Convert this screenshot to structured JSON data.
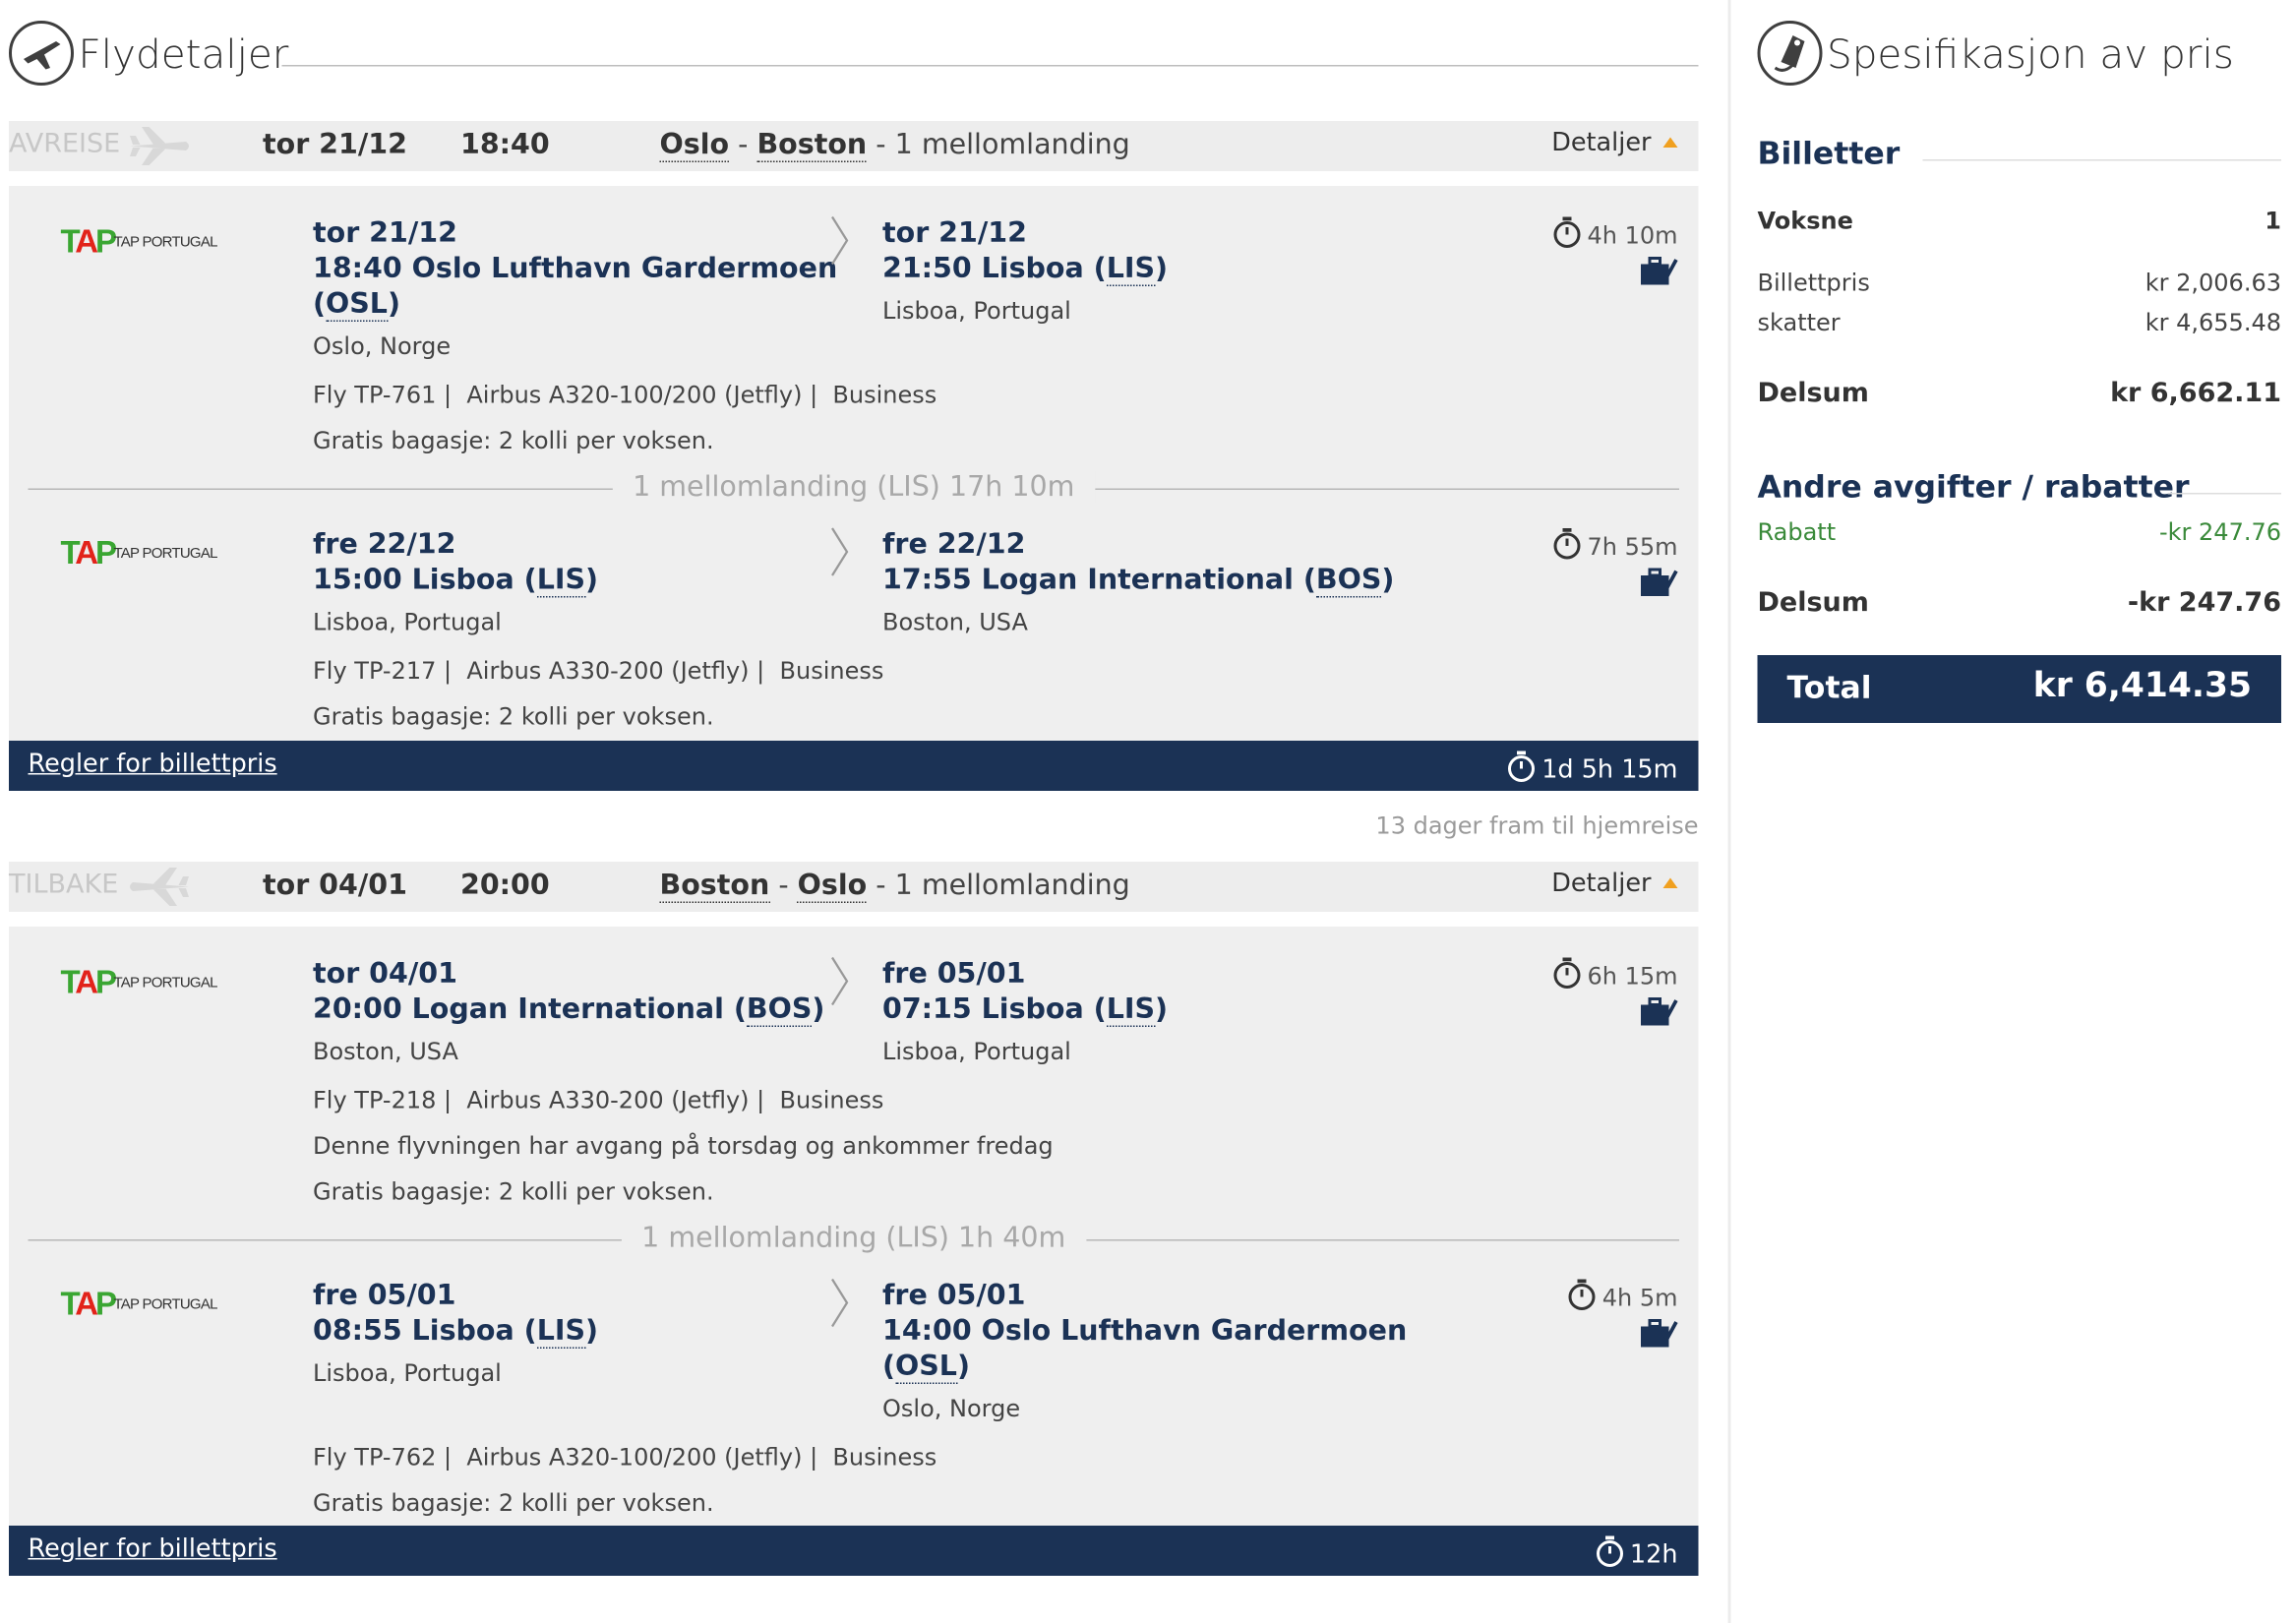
{
  "flight_details": {
    "title": "Flydetaljer",
    "trips": [
      {
        "direction": "AVREISE",
        "date": "tor 21/12",
        "time": "18:40",
        "route_from": "Oslo",
        "route_to": "Boston",
        "stops": "1 mellomlanding",
        "details_label": "Detaljer",
        "segments": [
          {
            "airline": "TAP PORTUGAL",
            "dep_date": "tor 21/12",
            "dep_time_place": "18:40 Oslo Lufthavn Gardermoen",
            "dep_code": "OSL",
            "dep_city": "Oslo, Norge",
            "arr_date": "tor 21/12",
            "arr_time_place": "21:50 Lisboa",
            "arr_code": "LIS",
            "arr_city": "Lisboa, Portugal",
            "duration": "4h 10m",
            "flight": "Fly TP-761",
            "aircraft": "Airbus A320-100/200 (Jetfly)",
            "cabin": "Business",
            "baggage": "Gratis bagasje: 2 kolli per voksen."
          },
          {
            "airline": "TAP PORTUGAL",
            "dep_date": "fre 22/12",
            "dep_time_place": "15:00 Lisboa",
            "dep_code": "LIS",
            "dep_city": "Lisboa, Portugal",
            "arr_date": "fre 22/12",
            "arr_time_place": "17:55 Logan International",
            "arr_code": "BOS",
            "arr_city": "Boston, USA",
            "duration": "7h 55m",
            "flight": "Fly TP-217",
            "aircraft": "Airbus A330-200 (Jetfly)",
            "cabin": "Business",
            "baggage": "Gratis bagasje: 2 kolli per voksen."
          }
        ],
        "layover": "1 mellomlanding (LIS) 17h 10m",
        "rules_label": "Regler for billettpris",
        "total_duration": "1d 5h 15m"
      },
      {
        "direction": "TILBAKE",
        "date": "tor 04/01",
        "time": "20:00",
        "route_from": "Boston",
        "route_to": "Oslo",
        "stops": "1 mellomlanding",
        "details_label": "Detaljer",
        "segments": [
          {
            "airline": "TAP PORTUGAL",
            "dep_date": "tor 04/01",
            "dep_time_place": "20:00 Logan International",
            "dep_code": "BOS",
            "dep_city": "Boston, USA",
            "arr_date": "fre 05/01",
            "arr_time_place": "07:15 Lisboa",
            "arr_code": "LIS",
            "arr_city": "Lisboa, Portugal",
            "duration": "6h 15m",
            "flight": "Fly TP-218",
            "aircraft": "Airbus A330-200 (Jetfly)",
            "cabin": "Business",
            "note": "Denne flyvningen har avgang på torsdag og ankommer fredag",
            "baggage": "Gratis bagasje: 2 kolli per voksen."
          },
          {
            "airline": "TAP PORTUGAL",
            "dep_date": "fre 05/01",
            "dep_time_place": "08:55 Lisboa",
            "dep_code": "LIS",
            "dep_city": "Lisboa, Portugal",
            "arr_date": "fre 05/01",
            "arr_time_place": "14:00 Oslo Lufthavn Gardermoen",
            "arr_code": "OSL",
            "arr_city": "Oslo, Norge",
            "duration": "4h 5m",
            "flight": "Fly TP-762",
            "aircraft": "Airbus A320-100/200 (Jetfly)",
            "cabin": "Business",
            "baggage": "Gratis bagasje: 2 kolli per voksen."
          }
        ],
        "layover": "1 mellomlanding (LIS) 1h 40m",
        "rules_label": "Regler for billettpris",
        "total_duration": "12h"
      }
    ],
    "days_until_return": "13 dager fram til hjemreise"
  },
  "price": {
    "title": "Spesifikasjon av pris",
    "tickets_heading": "Billetter",
    "adults_label": "Voksne",
    "adults_count": "1",
    "ticket_price_label": "Billettpris",
    "ticket_price": "kr 2,006.63",
    "taxes_label": "skatter",
    "taxes": "kr 4,655.48",
    "subtotal_label": "Delsum",
    "subtotal": "kr 6,662.11",
    "other_heading": "Andre avgifter / rabatter",
    "discount_label": "Rabatt",
    "discount": "-kr 247.76",
    "other_subtotal_label": "Delsum",
    "other_subtotal": "-kr 247.76",
    "total_label": "Total",
    "total": "kr 6,414.35"
  },
  "colors": {
    "navy": "#1b3255",
    "accent": "#f0a020",
    "discount_green": "#3a8a3a",
    "tap_green": "#3aa632",
    "tap_red": "#e2231a"
  },
  "icons": [
    "plane-circle-icon",
    "price-tag-icon",
    "plane-icon",
    "chevron-right-icon",
    "stopwatch-icon",
    "baggage-icon",
    "caret-up-icon"
  ]
}
